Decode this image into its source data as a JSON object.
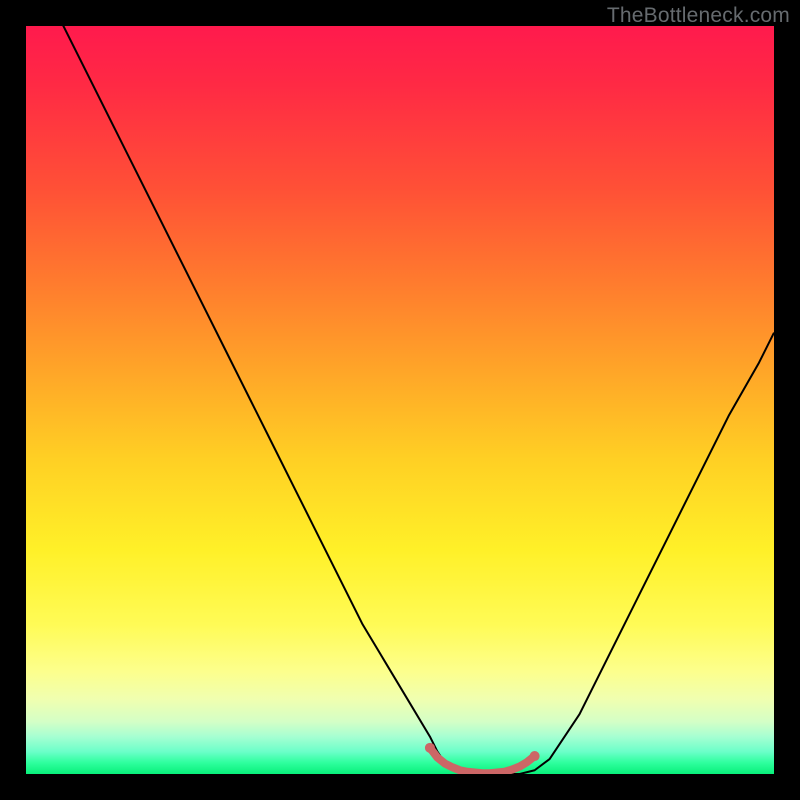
{
  "watermark": "TheBottleneck.com",
  "chart_data": {
    "type": "line",
    "title": "",
    "xlabel": "",
    "ylabel": "",
    "xlim": [
      0,
      100
    ],
    "ylim": [
      0,
      100
    ],
    "series": [
      {
        "name": "bottleneck-curve",
        "x": [
          0,
          3,
          6,
          9,
          12,
          15,
          18,
          21,
          24,
          27,
          30,
          33,
          36,
          39,
          42,
          45,
          48,
          51,
          54,
          55,
          56,
          58,
          60,
          62,
          64,
          66,
          68,
          70,
          74,
          78,
          82,
          86,
          90,
          94,
          98,
          100
        ],
        "y": [
          110,
          104,
          98,
          92,
          86,
          80,
          74,
          68,
          62,
          56,
          50,
          44,
          38,
          32,
          26,
          20,
          15,
          10,
          5,
          3,
          1.5,
          0.5,
          0,
          0,
          0,
          0,
          0.5,
          2,
          8,
          16,
          24,
          32,
          40,
          48,
          55,
          59
        ]
      }
    ],
    "highlight": {
      "name": "flat-minimum-band",
      "color": "#cc6666",
      "x": [
        54,
        55,
        56,
        57,
        58,
        59,
        60,
        61,
        62,
        63,
        64,
        65,
        66,
        67,
        68
      ],
      "y": [
        3.5,
        2.2,
        1.4,
        0.9,
        0.5,
        0.3,
        0.2,
        0.1,
        0.1,
        0.2,
        0.3,
        0.6,
        1.0,
        1.6,
        2.4
      ]
    }
  }
}
